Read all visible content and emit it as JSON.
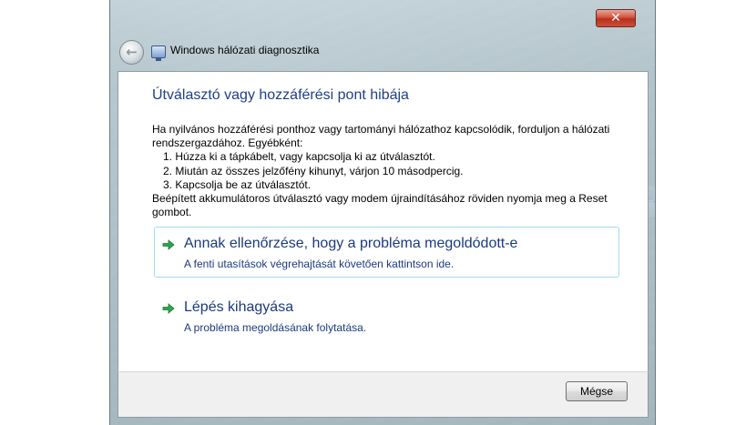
{
  "window": {
    "title": "Windows hálózati diagnosztika",
    "close_label": "✕"
  },
  "content": {
    "heading": "Útválasztó vagy hozzáférési pont hibája",
    "intro": "Ha nyilvános hozzáférési ponthoz vagy tartományi hálózathoz kapcsolódik, forduljon a hálózati rendszergazdához. Egyébként:",
    "steps": [
      "1.  Húzza ki a tápkábelt, vagy kapcsolja ki az útválasztót.",
      "2.  Miután az összes jelzőfény kihunyt, várjon 10 másodpercig.",
      "3.  Kapcsolja be az útválasztót."
    ],
    "outro": "Beépített akkumulátoros útválasztó vagy modem újraindításához röviden nyomja meg a Reset gombot."
  },
  "options": [
    {
      "title": "Annak ellenőrzése, hogy a probléma megoldódott-e",
      "description": "A fenti utasítások végrehajtását követően kattintson ide."
    },
    {
      "title": "Lépés kihagyása",
      "description": "A probléma megoldásának folytatása."
    }
  ],
  "footer": {
    "cancel_label": "Mégse"
  },
  "colors": {
    "heading": "#1e3f88",
    "option_text": "#1b3a7e",
    "arrow": "#2ea44f",
    "option_border": "#9ddcf3"
  },
  "icons": {
    "back": "back-arrow-icon",
    "app": "network-diagnostics-icon",
    "option_arrow": "green-arrow-icon"
  }
}
